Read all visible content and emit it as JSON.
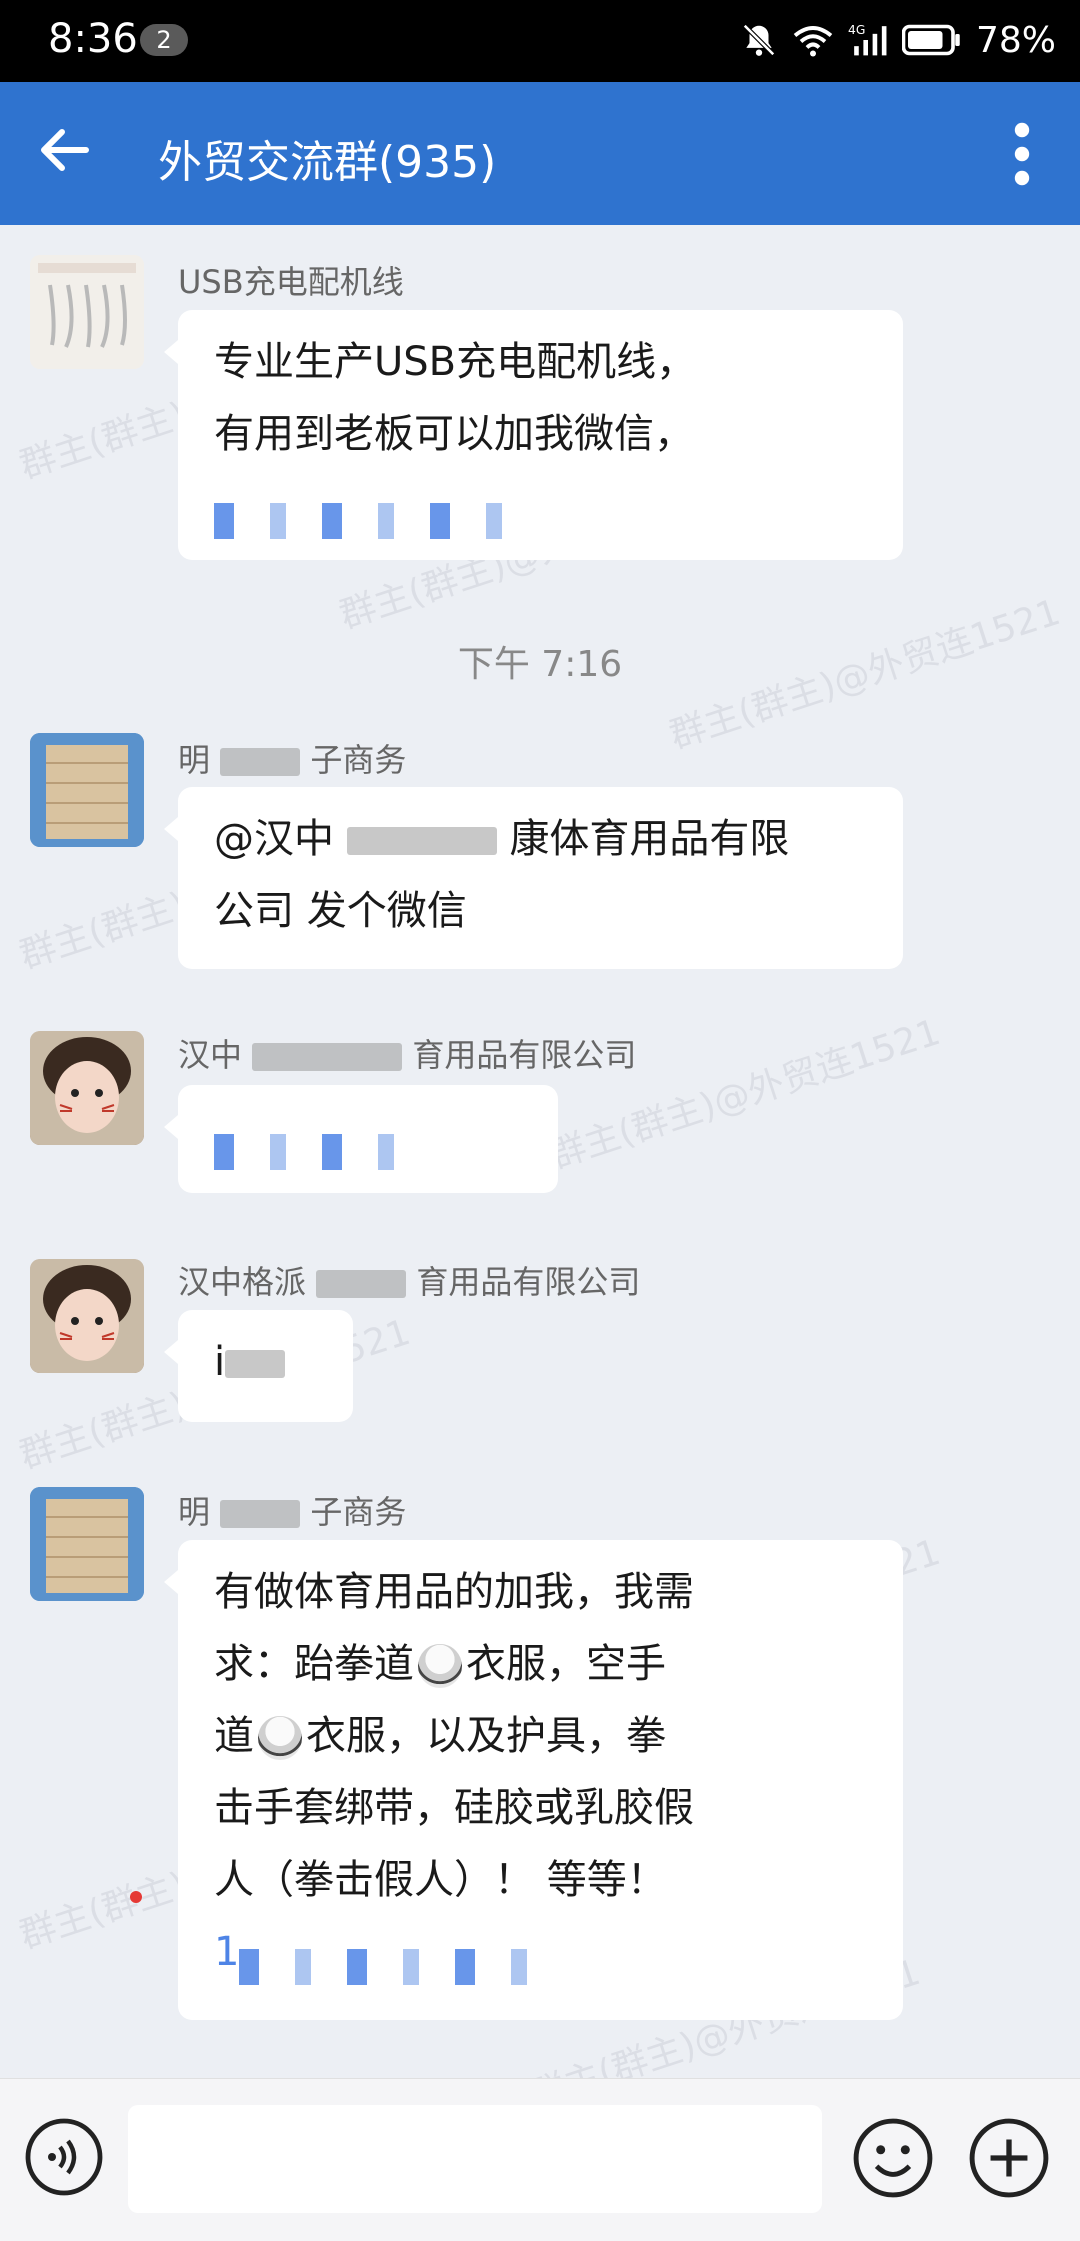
{
  "status_bar": {
    "time": "8:36",
    "notification_count": "2",
    "battery": "78%",
    "network": "4G"
  },
  "header": {
    "title": "外贸交流群(935)",
    "back_icon": "arrow-left-icon",
    "more_icon": "more-vertical-icon"
  },
  "watermark": "群主(群主)@外贸连1521",
  "messages": [
    {
      "sender": "USB充电配机线",
      "lines": [
        "专业生产USB充电配机线，",
        "有用到老板可以加我微信，"
      ],
      "redacted_line": true
    },
    {
      "time_separator": "下午 7:16"
    },
    {
      "sender_visible_start": "明",
      "sender_visible_end": "子商务",
      "line1_start": "@汉中",
      "line1_end": "康体育用品有限",
      "line2": "公司  发个微信"
    },
    {
      "sender_visible_start": "汉中",
      "sender_visible_end": "育用品有限公司",
      "redacted_line": true
    },
    {
      "sender_visible_start": "汉中格派",
      "sender_visible_end": "育用品有限公司",
      "text_start": "i"
    },
    {
      "sender_visible_start": "明",
      "sender_visible_end": "子商务",
      "line1": "有做体育用品的加我，我需",
      "line2_start": "求：跆拳道",
      "line2_end": "衣服，空手",
      "line3_start": "道",
      "line3_end": "衣服，以及护具，拳",
      "line4": "击手套绑带，硅胶或乳胶假",
      "line5": "人（拳击假人）！ 等等！",
      "line6_start": "1",
      "emoji_name": "martial-arts-uniform-icon"
    }
  ],
  "input_bar": {
    "placeholder": "",
    "voice_icon": "voice-icon",
    "emoji_icon": "emoji-icon",
    "plus_icon": "plus-icon"
  },
  "colors": {
    "header": "#2f73cf",
    "background": "#eceff4",
    "bubble": "#ffffff",
    "status_bar": "#000000"
  }
}
